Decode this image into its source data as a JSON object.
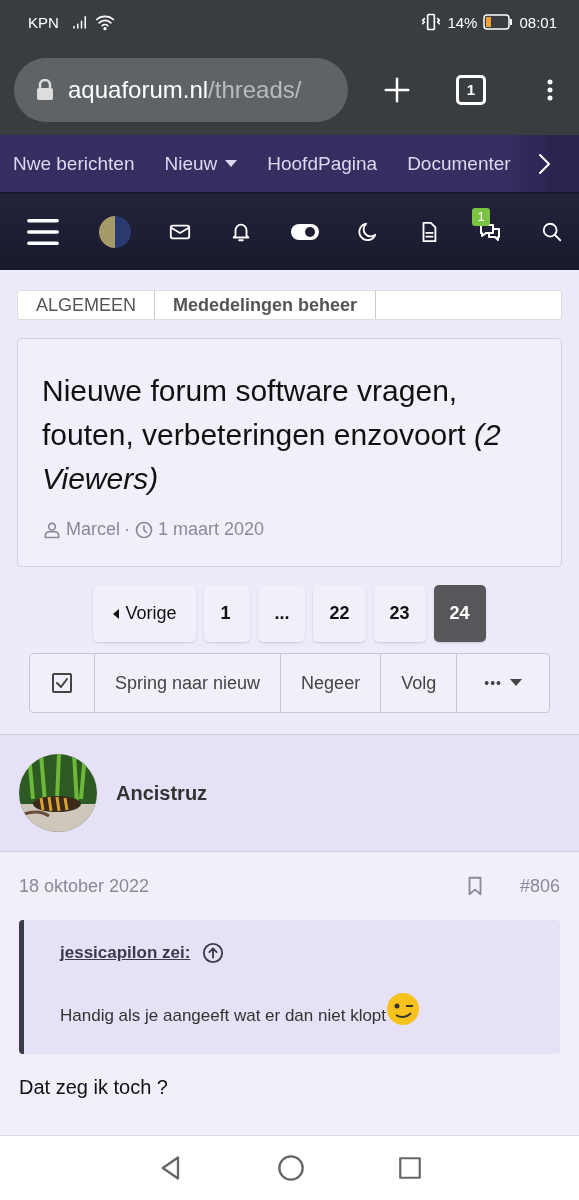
{
  "status_bar": {
    "carrier": "KPN",
    "battery": "14%",
    "time": "08:01"
  },
  "browser": {
    "url_host": "aquaforum.nl",
    "url_path": "/threads/",
    "tab_count": "1"
  },
  "nav_tabs": [
    {
      "label": "Nwe berichten",
      "dropdown": false
    },
    {
      "label": "Nieuw",
      "dropdown": true
    },
    {
      "label": "HoofdPagina",
      "dropdown": false
    },
    {
      "label": "Documenter",
      "dropdown": false
    }
  ],
  "toolbar": {
    "chat_badge": "1"
  },
  "breadcrumb": [
    {
      "label": "ALGEMEEN",
      "bold": false
    },
    {
      "label": "Mededelingen beheer",
      "bold": true
    }
  ],
  "thread": {
    "title": "Nieuwe forum software vragen, fouten, verbeteringen enzovoort *(2 Viewers)*",
    "author": "Marcel",
    "separator": "·",
    "date": "1 maart 2020"
  },
  "pagination": [
    {
      "label": "Vorige",
      "kind": "prev",
      "selected": false
    },
    {
      "label": "1",
      "kind": "page",
      "selected": false
    },
    {
      "label": "...",
      "kind": "page",
      "selected": false
    },
    {
      "label": "22",
      "kind": "page",
      "selected": false
    },
    {
      "label": "23",
      "kind": "page",
      "selected": false
    },
    {
      "label": "24",
      "kind": "page",
      "selected": true
    }
  ],
  "actions": [
    {
      "kind": "check"
    },
    {
      "kind": "text",
      "label": "Spring naar nieuw"
    },
    {
      "kind": "text",
      "label": "Negeer"
    },
    {
      "kind": "text",
      "label": "Volg"
    },
    {
      "kind": "more",
      "label": "•••"
    }
  ],
  "post": {
    "username": "Ancistruz",
    "date": "18 oktober 2022",
    "number": "#806",
    "quote_author": "jessicapilon zei:",
    "quote_text": "Handig als je aangeeft wat er dan niet klopt",
    "body": "Dat zeg ik toch ?"
  }
}
